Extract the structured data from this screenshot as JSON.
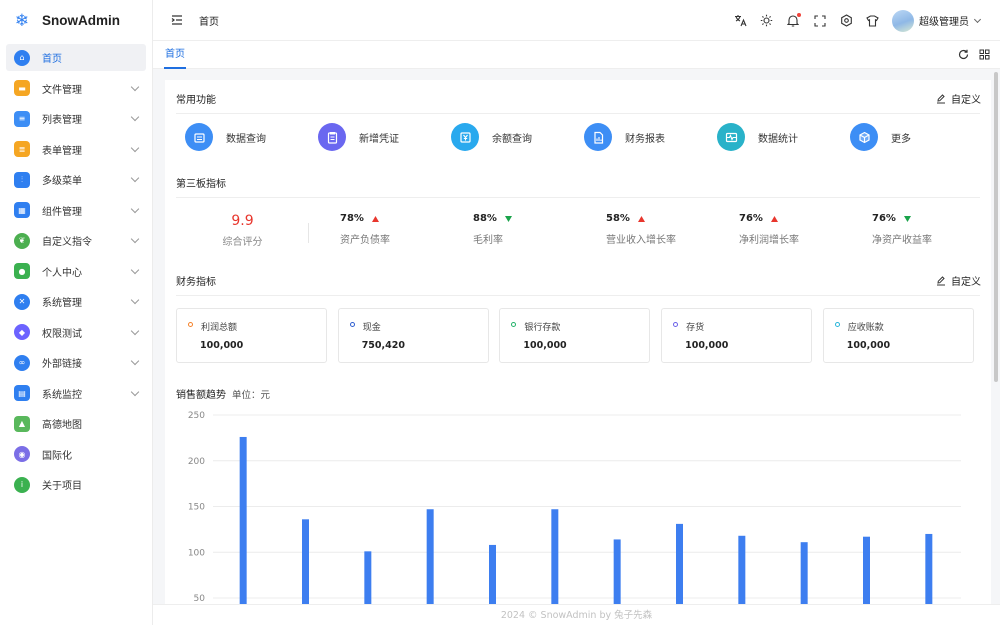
{
  "app": {
    "name": "SnowAdmin"
  },
  "sidebar": {
    "items": [
      {
        "label": "首页",
        "icon": "home-icon",
        "color": "#2f7ff0",
        "round": true,
        "active": true,
        "arrow": false
      },
      {
        "label": "文件管理",
        "icon": "folder-icon",
        "color": "#f5a623",
        "arrow": true
      },
      {
        "label": "列表管理",
        "icon": "list-icon",
        "color": "#3d8ef5",
        "arrow": true
      },
      {
        "label": "表单管理",
        "icon": "form-icon",
        "color": "#f5a623",
        "arrow": true
      },
      {
        "label": "多级菜单",
        "icon": "sliders-icon",
        "color": "#2f7ff0",
        "arrow": true
      },
      {
        "label": "组件管理",
        "icon": "grid-icon",
        "color": "#2f7ff0",
        "arrow": true
      },
      {
        "label": "自定义指令",
        "icon": "leaf-icon",
        "color": "#4caf50",
        "round": true,
        "arrow": true
      },
      {
        "label": "个人中心",
        "icon": "user-icon",
        "color": "#3bb150",
        "arrow": true
      },
      {
        "label": "系统管理",
        "icon": "tools-icon",
        "color": "#2f7ff0",
        "round": true,
        "arrow": true
      },
      {
        "label": "权限测试",
        "icon": "shield-icon",
        "color": "#6c63ff",
        "round": true,
        "arrow": true
      },
      {
        "label": "外部链接",
        "icon": "link-icon",
        "color": "#2f7ff0",
        "round": true,
        "arrow": true
      },
      {
        "label": "系统监控",
        "icon": "monitor-icon",
        "color": "#2f7ff0",
        "arrow": true
      },
      {
        "label": "高德地图",
        "icon": "map-icon",
        "color": "#59b85c",
        "arrow": false
      },
      {
        "label": "国际化",
        "icon": "planet-icon",
        "color": "#7b6ee6",
        "round": true,
        "arrow": false
      },
      {
        "label": "关于项目",
        "icon": "info-icon",
        "color": "#3bb150",
        "round": true,
        "arrow": false
      }
    ]
  },
  "header": {
    "breadcrumb": "首页",
    "user_name": "超级管理员"
  },
  "tabs": {
    "home": "首页"
  },
  "common": {
    "title": "常用功能",
    "customize": "自定义",
    "items": [
      {
        "label": "数据查询",
        "icon": "query-icon",
        "color": "#3d8ef5"
      },
      {
        "label": "新增凭证",
        "icon": "clipboard-icon",
        "color": "#6a67f0"
      },
      {
        "label": "余额查询",
        "icon": "yen-icon",
        "color": "#29a9ee"
      },
      {
        "label": "财务报表",
        "icon": "report-icon",
        "color": "#3d8ef5"
      },
      {
        "label": "数据统计",
        "icon": "pulse-icon",
        "color": "#29b2c9"
      },
      {
        "label": "更多",
        "icon": "cube-icon",
        "color": "#3d8ef5"
      }
    ]
  },
  "board": {
    "title": "第三板指标",
    "score": {
      "value": "9.9",
      "label": "综合评分"
    },
    "kpis": [
      {
        "value": "78%",
        "label": "资产负债率",
        "trend": "up"
      },
      {
        "value": "88%",
        "label": "毛利率",
        "trend": "down"
      },
      {
        "value": "58%",
        "label": "营业收入增长率",
        "trend": "up"
      },
      {
        "value": "76%",
        "label": "净利润增长率",
        "trend": "up"
      },
      {
        "value": "76%",
        "label": "净资产收益率",
        "trend": "down"
      }
    ],
    "up_color": "#e8362d",
    "down_color": "#1aa34a"
  },
  "finance": {
    "title": "财务指标",
    "customize": "自定义",
    "items": [
      {
        "name": "利润总额",
        "value": "100,000",
        "color": "#f5822a"
      },
      {
        "name": "现金",
        "value": "750,420",
        "color": "#2f5fd0"
      },
      {
        "name": "银行存款",
        "value": "100,000",
        "color": "#22b26a"
      },
      {
        "name": "存货",
        "value": "100,000",
        "color": "#6b62e8"
      },
      {
        "name": "应收账款",
        "value": "100,000",
        "color": "#2ab6d9"
      }
    ]
  },
  "chart_data": {
    "type": "bar",
    "title": "销售额趋势",
    "unit": "单位：元",
    "ylim": [
      50,
      250
    ],
    "yticks": [
      250,
      200,
      150,
      100,
      50
    ],
    "values": [
      226,
      136,
      101,
      147,
      108,
      147,
      114,
      131,
      118,
      111,
      117,
      120
    ],
    "color": "#3d7ef0",
    "grid": true
  },
  "footer": {
    "text": "2024 © SnowAdmin by 兔子先森"
  }
}
